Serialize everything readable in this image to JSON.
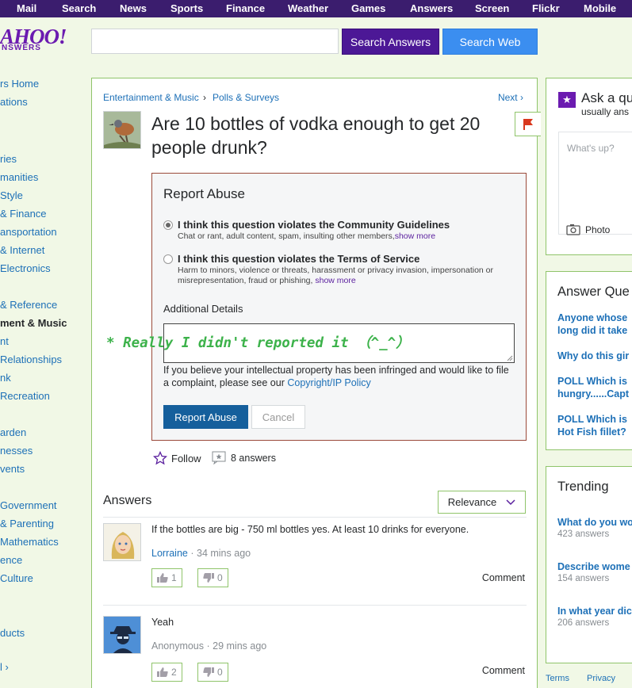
{
  "topnav": [
    "Mail",
    "Search",
    "News",
    "Sports",
    "Finance",
    "Weather",
    "Games",
    "Answers",
    "Screen",
    "Flickr",
    "Mobile"
  ],
  "logo": {
    "text": "AHOO!",
    "sub": "NSWERS"
  },
  "search": {
    "placeholder": "",
    "answers_btn": "Search Answers",
    "web_btn": "Search Web"
  },
  "sidebar": [
    "rs Home",
    "ations",
    "ries",
    "manities",
    "Style",
    "& Finance",
    "ansportation",
    "& Internet",
    "Electronics",
    "& Reference",
    "ment & Music",
    "nt",
    "Relationships",
    "nk",
    "Recreation",
    "arden",
    "nesses",
    "vents",
    "Government",
    "& Parenting",
    "Mathematics",
    "ence",
    "Culture",
    "ducts",
    "l"
  ],
  "question": {
    "breadcrumb": [
      "Entertainment & Music",
      "Polls & Surveys"
    ],
    "next": "Next",
    "title": "Are 10 bottles of vodka enough to get 20 people drunk?",
    "follow": "Follow",
    "answers_count": "8 answers"
  },
  "report": {
    "title": "Report Abuse",
    "opt1_title": "I think this question violates the Community Guidelines",
    "opt1_desc": "Chat or rant, adult content, spam, insulting other members,",
    "opt1_more": "show more",
    "opt2_title": "I think this question violates the Terms of Service",
    "opt2_desc": "Harm to minors, violence or threats, harassment or privacy invasion, impersonation or misrepresentation, fraud or phishing,",
    "opt2_more": "show more",
    "additional": "Additional Details",
    "ip_text": "If you believe your intellectual property has been infringed and would like to file a complaint, please see our",
    "ip_link": "Copyright/IP Policy",
    "report_btn": "Report Abuse",
    "cancel_btn": "Cancel"
  },
  "overlay_note": "* Really I didn't reported it （^_^）",
  "answers": {
    "label": "Answers",
    "sort": "Relevance",
    "items": [
      {
        "text": "If the bottles are big - 750 ml bottles yes. At least 10 drinks for everyone.",
        "user": "Lorraine",
        "time": "· 34 mins ago",
        "up": "1",
        "down": "0",
        "comment": "Comment"
      },
      {
        "text": "Yeah",
        "user": "Anonymous",
        "time": "· 29 mins ago",
        "up": "2",
        "down": "0",
        "comment": "Comment"
      }
    ]
  },
  "ask": {
    "title": "Ask a qu",
    "sub": "usually ans",
    "placeholder": "What's up?",
    "photo": "Photo"
  },
  "answer_questions": {
    "title": "Answer Que",
    "items": [
      [
        "Anyone whose",
        "long did it take"
      ],
      [
        "Why do this gir"
      ],
      [
        "POLL Which is",
        "hungry......Capt"
      ],
      [
        "POLL Which is",
        "Hot Fish fillet?"
      ]
    ]
  },
  "trending": {
    "title": "Trending",
    "items": [
      {
        "q": "What do you wo",
        "count": "423 answers"
      },
      {
        "q": "Describe wome",
        "count": "154 answers"
      },
      {
        "q": "In what year dic",
        "count": "206 answers"
      }
    ]
  },
  "footer": {
    "terms": "Terms",
    "privacy": "Privacy"
  },
  "colors": {
    "nav": "#3b1d6e",
    "accent_green": "#8fc46a",
    "link": "#1d70b7",
    "purple": "#4c1896",
    "blue": "#3b8ef0",
    "note_green": "#3cb24a"
  }
}
